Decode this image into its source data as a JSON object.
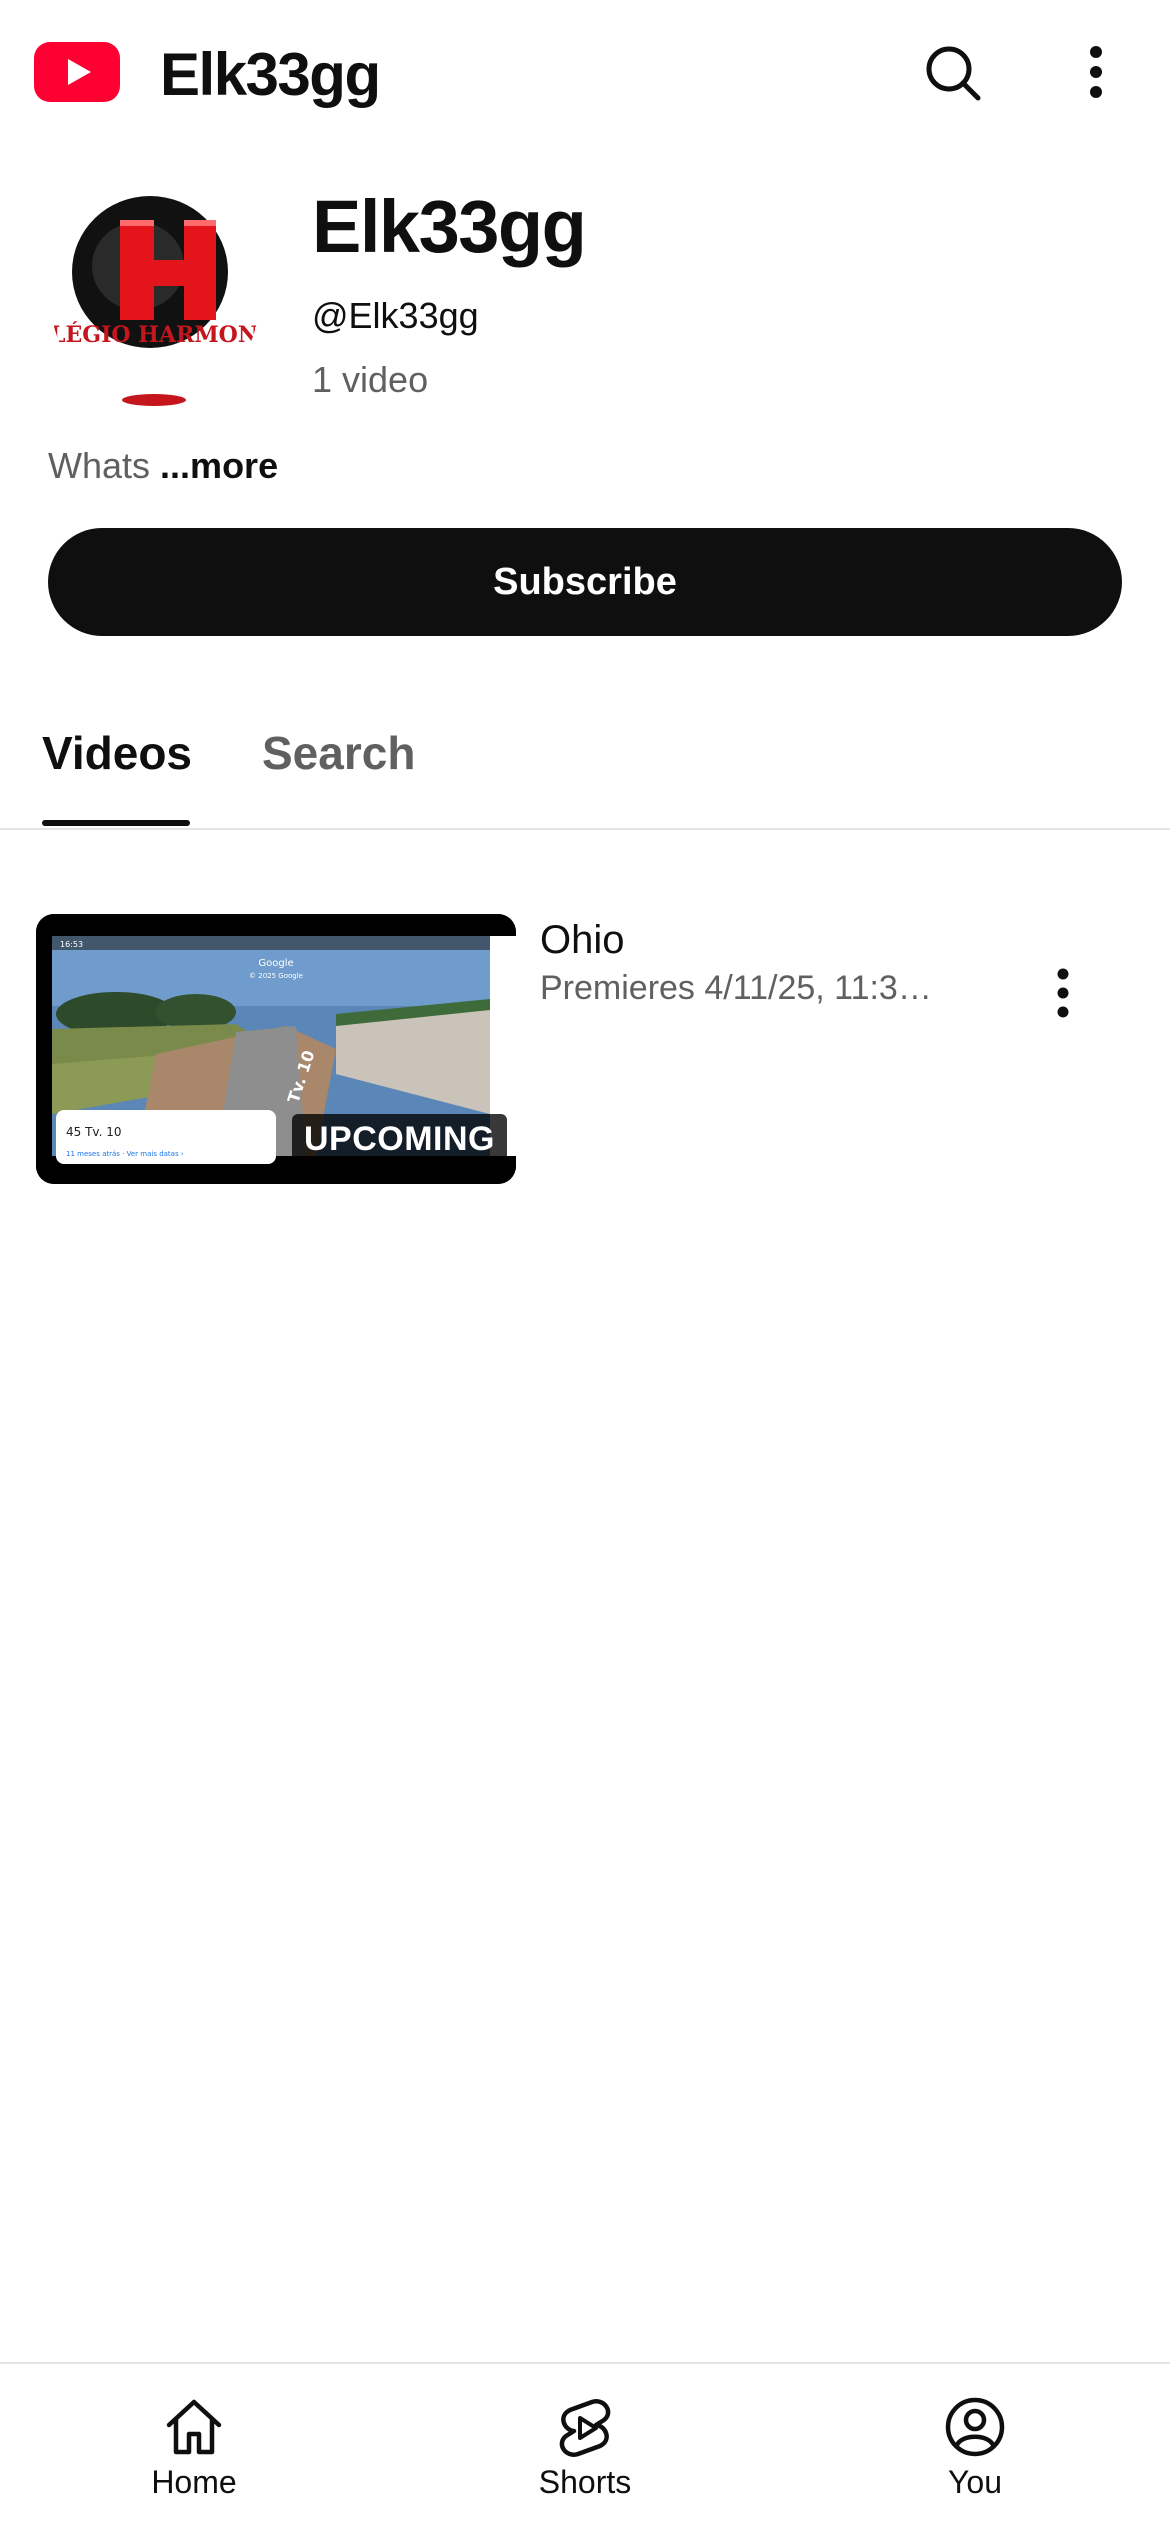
{
  "header": {
    "app_title": "Elk33gg",
    "icons": [
      "youtube-logo",
      "search-icon",
      "more-vert-icon"
    ],
    "brand_color": "#FF0033"
  },
  "channel": {
    "name": "Elk33gg",
    "handle": "@Elk33gg",
    "video_count": "1 video",
    "description": "Whats",
    "more_label": "...more",
    "avatar_text": "LÉGIO HARMON",
    "subscribe_label": "Subscribe"
  },
  "tabs": [
    {
      "label": "Videos",
      "selected": true
    },
    {
      "label": "Search",
      "selected": false
    }
  ],
  "videos": [
    {
      "title": "Ohio",
      "meta": "Premieres 4/11/25, 11:3…",
      "badge": "UPCOMING",
      "thumbnail": {
        "status_time": "16:53",
        "app": "Google",
        "copyright": "© 2025 Google",
        "street": "Tv. 10",
        "address": "45 Tv. 10",
        "caption": "11 meses atrás · Ver mais datas  ›"
      }
    }
  ],
  "bottom_nav": [
    {
      "label": "Home",
      "icon": "home-icon"
    },
    {
      "label": "Shorts",
      "icon": "shorts-icon"
    },
    {
      "label": "You",
      "icon": "account-icon"
    }
  ]
}
